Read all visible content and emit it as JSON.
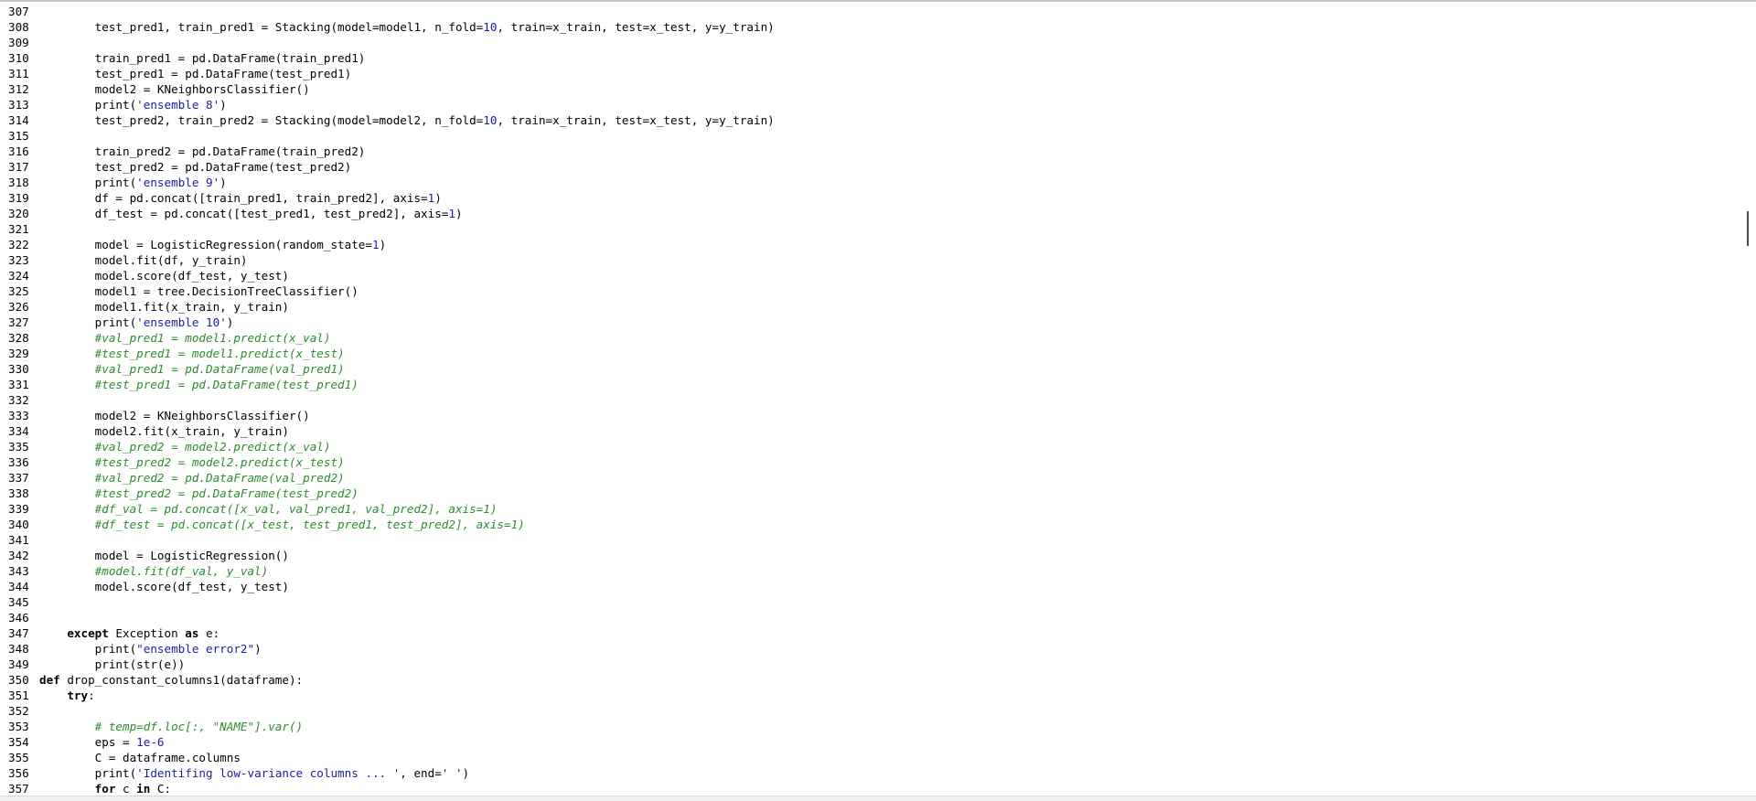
{
  "editor": {
    "lines": [
      {
        "num": "307",
        "indent": 0,
        "tokens": []
      },
      {
        "num": "308",
        "indent": 2,
        "tokens": [
          [
            "t",
            "test_pred1, train_pred1 = Stacking(model=model1, n_fold="
          ],
          [
            "n",
            "10"
          ],
          [
            "t",
            ", train=x_train, test=x_test, y=y_train)"
          ]
        ]
      },
      {
        "num": "309",
        "indent": 0,
        "tokens": []
      },
      {
        "num": "310",
        "indent": 2,
        "tokens": [
          [
            "t",
            "train_pred1 = pd.DataFrame(train_pred1)"
          ]
        ]
      },
      {
        "num": "311",
        "indent": 2,
        "tokens": [
          [
            "t",
            "test_pred1 = pd.DataFrame(test_pred1)"
          ]
        ]
      },
      {
        "num": "312",
        "indent": 2,
        "tokens": [
          [
            "t",
            "model2 = KNeighborsClassifier()"
          ]
        ]
      },
      {
        "num": "313",
        "indent": 2,
        "tokens": [
          [
            "t",
            "print("
          ],
          [
            "s",
            "'ensemble 8'"
          ],
          [
            "t",
            ")"
          ]
        ]
      },
      {
        "num": "314",
        "indent": 2,
        "tokens": [
          [
            "t",
            "test_pred2, train_pred2 = Stacking(model=model2, n_fold="
          ],
          [
            "n",
            "10"
          ],
          [
            "t",
            ", train=x_train, test=x_test, y=y_train)"
          ]
        ]
      },
      {
        "num": "315",
        "indent": 0,
        "tokens": []
      },
      {
        "num": "316",
        "indent": 2,
        "tokens": [
          [
            "t",
            "train_pred2 = pd.DataFrame(train_pred2)"
          ]
        ]
      },
      {
        "num": "317",
        "indent": 2,
        "tokens": [
          [
            "t",
            "test_pred2 = pd.DataFrame(test_pred2)"
          ]
        ]
      },
      {
        "num": "318",
        "indent": 2,
        "tokens": [
          [
            "t",
            "print("
          ],
          [
            "s",
            "'ensemble 9'"
          ],
          [
            "t",
            ")"
          ]
        ]
      },
      {
        "num": "319",
        "indent": 2,
        "tokens": [
          [
            "t",
            "df = pd.concat([train_pred1, train_pred2], axis="
          ],
          [
            "n",
            "1"
          ],
          [
            "t",
            ")"
          ]
        ]
      },
      {
        "num": "320",
        "indent": 2,
        "tokens": [
          [
            "t",
            "df_test = pd.concat([test_pred1, test_pred2], axis="
          ],
          [
            "n",
            "1"
          ],
          [
            "t",
            ")"
          ]
        ]
      },
      {
        "num": "321",
        "indent": 0,
        "tokens": []
      },
      {
        "num": "322",
        "indent": 2,
        "tokens": [
          [
            "t",
            "model = LogisticRegression(random_state="
          ],
          [
            "n",
            "1"
          ],
          [
            "t",
            ")"
          ]
        ]
      },
      {
        "num": "323",
        "indent": 2,
        "tokens": [
          [
            "t",
            "model.fit(df, y_train)"
          ]
        ]
      },
      {
        "num": "324",
        "indent": 2,
        "tokens": [
          [
            "t",
            "model.score(df_test, y_test)"
          ]
        ]
      },
      {
        "num": "325",
        "indent": 2,
        "tokens": [
          [
            "t",
            "model1 = tree.DecisionTreeClassifier()"
          ]
        ]
      },
      {
        "num": "326",
        "indent": 2,
        "tokens": [
          [
            "t",
            "model1.fit(x_train, y_train)"
          ]
        ]
      },
      {
        "num": "327",
        "indent": 2,
        "tokens": [
          [
            "t",
            "print("
          ],
          [
            "s",
            "'ensemble 10'"
          ],
          [
            "t",
            ")"
          ]
        ]
      },
      {
        "num": "328",
        "indent": 2,
        "tokens": [
          [
            "c",
            "#val_pred1 = model1.predict(x_val)"
          ]
        ]
      },
      {
        "num": "329",
        "indent": 2,
        "tokens": [
          [
            "c",
            "#test_pred1 = model1.predict(x_test)"
          ]
        ]
      },
      {
        "num": "330",
        "indent": 2,
        "tokens": [
          [
            "c",
            "#val_pred1 = pd.DataFrame(val_pred1)"
          ]
        ]
      },
      {
        "num": "331",
        "indent": 2,
        "tokens": [
          [
            "c",
            "#test_pred1 = pd.DataFrame(test_pred1)"
          ]
        ]
      },
      {
        "num": "332",
        "indent": 0,
        "tokens": []
      },
      {
        "num": "333",
        "indent": 2,
        "tokens": [
          [
            "t",
            "model2 = KNeighborsClassifier()"
          ]
        ]
      },
      {
        "num": "334",
        "indent": 2,
        "tokens": [
          [
            "t",
            "model2.fit(x_train, y_train)"
          ]
        ]
      },
      {
        "num": "335",
        "indent": 2,
        "tokens": [
          [
            "c",
            "#val_pred2 = model2.predict(x_val)"
          ]
        ]
      },
      {
        "num": "336",
        "indent": 2,
        "tokens": [
          [
            "c",
            "#test_pred2 = model2.predict(x_test)"
          ]
        ]
      },
      {
        "num": "337",
        "indent": 2,
        "tokens": [
          [
            "c",
            "#val_pred2 = pd.DataFrame(val_pred2)"
          ]
        ]
      },
      {
        "num": "338",
        "indent": 2,
        "tokens": [
          [
            "c",
            "#test_pred2 = pd.DataFrame(test_pred2)"
          ]
        ]
      },
      {
        "num": "339",
        "indent": 2,
        "tokens": [
          [
            "c",
            "#df_val = pd.concat([x_val, val_pred1, val_pred2], axis=1)"
          ]
        ]
      },
      {
        "num": "340",
        "indent": 2,
        "tokens": [
          [
            "c",
            "#df_test = pd.concat([x_test, test_pred1, test_pred2], axis=1)"
          ]
        ]
      },
      {
        "num": "341",
        "indent": 0,
        "tokens": []
      },
      {
        "num": "342",
        "indent": 2,
        "tokens": [
          [
            "t",
            "model = LogisticRegression()"
          ]
        ]
      },
      {
        "num": "343",
        "indent": 2,
        "tokens": [
          [
            "c",
            "#model.fit(df_val, y_val)"
          ]
        ]
      },
      {
        "num": "344",
        "indent": 2,
        "tokens": [
          [
            "t",
            "model.score(df_test, y_test)"
          ]
        ]
      },
      {
        "num": "345",
        "indent": 0,
        "tokens": []
      },
      {
        "num": "346",
        "indent": 0,
        "tokens": []
      },
      {
        "num": "347",
        "indent": 1,
        "tokens": [
          [
            "k",
            "except"
          ],
          [
            "t",
            " Exception "
          ],
          [
            "k",
            "as"
          ],
          [
            "t",
            " e:"
          ]
        ]
      },
      {
        "num": "348",
        "indent": 2,
        "tokens": [
          [
            "t",
            "print("
          ],
          [
            "s",
            "\"ensemble error2\""
          ],
          [
            "t",
            ")"
          ]
        ]
      },
      {
        "num": "349",
        "indent": 2,
        "tokens": [
          [
            "t",
            "print(str(e))"
          ]
        ]
      },
      {
        "num": "350",
        "indent": 0,
        "tokens": [
          [
            "k",
            "def"
          ],
          [
            "t",
            " drop_constant_columns1(dataframe):"
          ]
        ]
      },
      {
        "num": "351",
        "indent": 1,
        "tokens": [
          [
            "k",
            "try"
          ],
          [
            "t",
            ":"
          ]
        ]
      },
      {
        "num": "352",
        "indent": 0,
        "tokens": []
      },
      {
        "num": "353",
        "indent": 2,
        "tokens": [
          [
            "c",
            "# temp=df.loc[:, \"NAME\"].var()"
          ]
        ]
      },
      {
        "num": "354",
        "indent": 2,
        "tokens": [
          [
            "t",
            "eps = "
          ],
          [
            "n",
            "1e-6"
          ]
        ]
      },
      {
        "num": "355",
        "indent": 2,
        "tokens": [
          [
            "t",
            "C = dataframe.columns"
          ]
        ]
      },
      {
        "num": "356",
        "indent": 2,
        "tokens": [
          [
            "t",
            "print("
          ],
          [
            "s",
            "'Identifing low-variance columns ... '"
          ],
          [
            "t",
            ", end="
          ],
          [
            "s",
            "' '"
          ],
          [
            "t",
            ")"
          ]
        ]
      },
      {
        "num": "357",
        "indent": 2,
        "tokens": [
          [
            "k",
            "for"
          ],
          [
            "t",
            " c "
          ],
          [
            "k",
            "in"
          ],
          [
            "t",
            " C:"
          ]
        ]
      }
    ]
  }
}
